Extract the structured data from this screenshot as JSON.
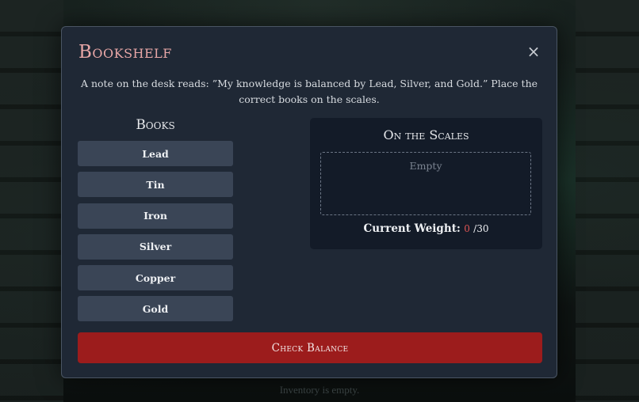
{
  "background": {
    "status_text": "Inventory is empty."
  },
  "modal": {
    "title": "Bookshelf",
    "close_label": "×",
    "note": "A note on the desk reads: ”My knowledge is balanced by Lead, Silver, and Gold.” Place the correct books on the scales.",
    "books_heading": "Books",
    "books": [
      {
        "label": "Lead"
      },
      {
        "label": "Tin"
      },
      {
        "label": "Iron"
      },
      {
        "label": "Silver"
      },
      {
        "label": "Copper"
      },
      {
        "label": "Gold"
      }
    ],
    "scales": {
      "title": "On the Scales",
      "empty_text": "Empty",
      "weight_label": "Current Weight:",
      "weight_current": "0",
      "weight_max": "/30"
    },
    "check_button": "Check Balance"
  },
  "colors": {
    "title": "#e8a7a7",
    "check_button": "#9c1c1c",
    "weight_current": "#e05555",
    "book_button": "#3a4556"
  }
}
